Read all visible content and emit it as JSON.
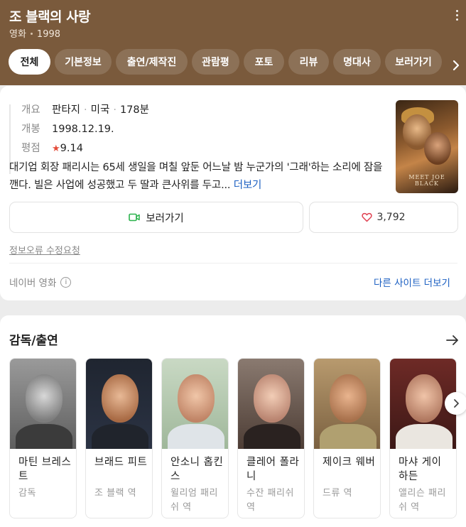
{
  "header": {
    "title": "조 블랙의 사랑",
    "category": "영화",
    "year": "1998"
  },
  "tabs": [
    {
      "label": "전체",
      "active": true
    },
    {
      "label": "기본정보"
    },
    {
      "label": "출연/제작진"
    },
    {
      "label": "관람평"
    },
    {
      "label": "포토"
    },
    {
      "label": "리뷰"
    },
    {
      "label": "명대사"
    },
    {
      "label": "보러가기"
    }
  ],
  "info": {
    "overview_label": "개요",
    "genre": "판타지",
    "country": "미국",
    "runtime": "178분",
    "release_label": "개봉",
    "release_date": "1998.12.19.",
    "rating_label": "평점",
    "rating_star": "★",
    "rating": "9.14",
    "synopsis": "대기업 회장 패리시는 65세 생일을 며칠 앞둔 어느날 밤 누군가의 '그래'하는 소리에 잠을 깬다. 빌은 사업에 성공했고 두 딸과 큰사위를 두고...",
    "more_label": "더보기",
    "poster_title": "MEET JOE BLACK"
  },
  "actions": {
    "watch_label": "보러가기",
    "like_count": "3,792"
  },
  "report_label": "정보오류 수정요청",
  "source": {
    "label": "네이버 영화",
    "other_sites_label": "다른 사이트 더보기"
  },
  "cast_section": {
    "title": "감독/출연",
    "people": [
      {
        "name": "마틴 브레스트",
        "role": "감독"
      },
      {
        "name": "브래드 피트",
        "role": "조 블랙 역"
      },
      {
        "name": "안소니 홉킨스",
        "role": "윌리엄 패리쉬 역"
      },
      {
        "name": "클레어 폴라니",
        "role": "수잔 패리쉬 역"
      },
      {
        "name": "제이크 웨버",
        "role": "드류 역"
      },
      {
        "name": "마샤 게이 하든",
        "role": "앨리슨 패리쉬 역"
      }
    ]
  },
  "colors": {
    "header_bg": "#7a5a3c",
    "link": "#1b5fc2",
    "rating_star": "#e44c3a",
    "watch_icon": "#2bb24c",
    "heart_icon": "#e04050"
  }
}
